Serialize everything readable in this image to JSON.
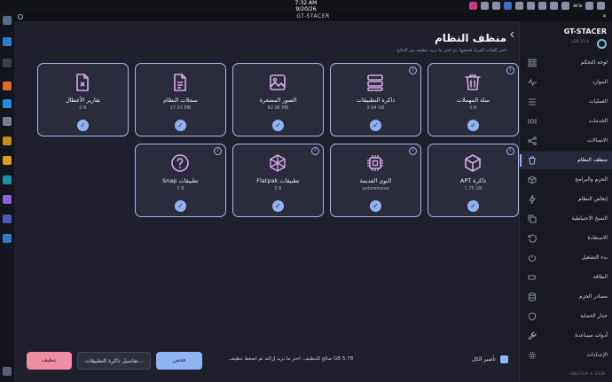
{
  "system_bar": {
    "time": "7:32 AM",
    "date": "9/20/26",
    "lang": "ara"
  },
  "window": {
    "title": "GT-STACER",
    "close": "✕"
  },
  "page": {
    "title": "منظف النظام",
    "subtitle": "اختر الفئات المراد فحصها، ثم اختر ما تريد تنظيفه من النتائج.",
    "collapse_icon": "chevron-left-icon"
  },
  "cards": [
    {
      "label": "سلة المهملات",
      "value": "0 B",
      "icon": "trash-icon",
      "info": true
    },
    {
      "label": "ذاكرة التطبيقات",
      "value": "3.94 GB",
      "icon": "storage-icon",
      "info": true
    },
    {
      "label": "الصور المصغرة",
      "value": "82.96 MB",
      "icon": "image-icon",
      "info": false
    },
    {
      "label": "سجلات النظام",
      "value": "17.93 MB",
      "icon": "file-text-icon",
      "info": false
    },
    {
      "label": "تقارير الأعطال",
      "value": "0 B",
      "icon": "file-x-icon",
      "info": false
    },
    {
      "label": "ذاكرة APT",
      "value": "1.75 GB",
      "icon": "package-icon",
      "info": true
    },
    {
      "label": "النوى القديمة",
      "value": "autoremove",
      "icon": "cpu-icon",
      "info": true
    },
    {
      "label": "تطبيقات Flatpak",
      "value": "0 B",
      "icon": "box-icon",
      "info": true
    },
    {
      "label": "تطبيقات Snap",
      "value": "0 B",
      "icon": "help-circle-icon",
      "info": true
    }
  ],
  "footer": {
    "note": "5.78 GB صالح للتنظيف. اختر ما تريد إزالته ثم اضغط تنظيف.",
    "clean_label": "تنظيف",
    "details_label": "تفاصيل ذاكرة التطبيقات...",
    "scan_label": "فحص",
    "select_all_label": "تأشير الكل"
  },
  "sidebar": {
    "app_name": "GT-STACER",
    "version": "v26.11.0",
    "footer": "GNU/TUX © 2026",
    "items": [
      {
        "label": "لوحة التحكم",
        "icon": "dashboard-icon"
      },
      {
        "label": "الموارد",
        "icon": "activity-icon"
      },
      {
        "label": "العمليات",
        "icon": "list-icon"
      },
      {
        "label": "الخدمات",
        "icon": "service-icon"
      },
      {
        "label": "الاتصالات",
        "icon": "share-icon"
      },
      {
        "label": "منظف النظام",
        "icon": "trash-icon",
        "active": true
      },
      {
        "label": "الحزم والبرامج",
        "icon": "package-icon"
      },
      {
        "label": "إنعاش النظام",
        "icon": "bolt-icon"
      },
      {
        "label": "النسخ الاحتياطية",
        "icon": "copy-icon"
      },
      {
        "label": "الاستعادة",
        "icon": "restore-icon"
      },
      {
        "label": "بدء التشغيل",
        "icon": "power-icon"
      },
      {
        "label": "الطاقة",
        "icon": "battery-icon"
      },
      {
        "label": "مصادر الحزم",
        "icon": "database-icon"
      },
      {
        "label": "جدار الحماية",
        "icon": "shield-icon"
      },
      {
        "label": "أدوات مساعدة",
        "icon": "wrench-icon"
      },
      {
        "label": "الإعدادات",
        "icon": "gear-icon"
      }
    ]
  },
  "colors": {
    "accent": "#8fb3f5",
    "danger": "#ee8ea4",
    "icon": "#d9a7ef"
  }
}
